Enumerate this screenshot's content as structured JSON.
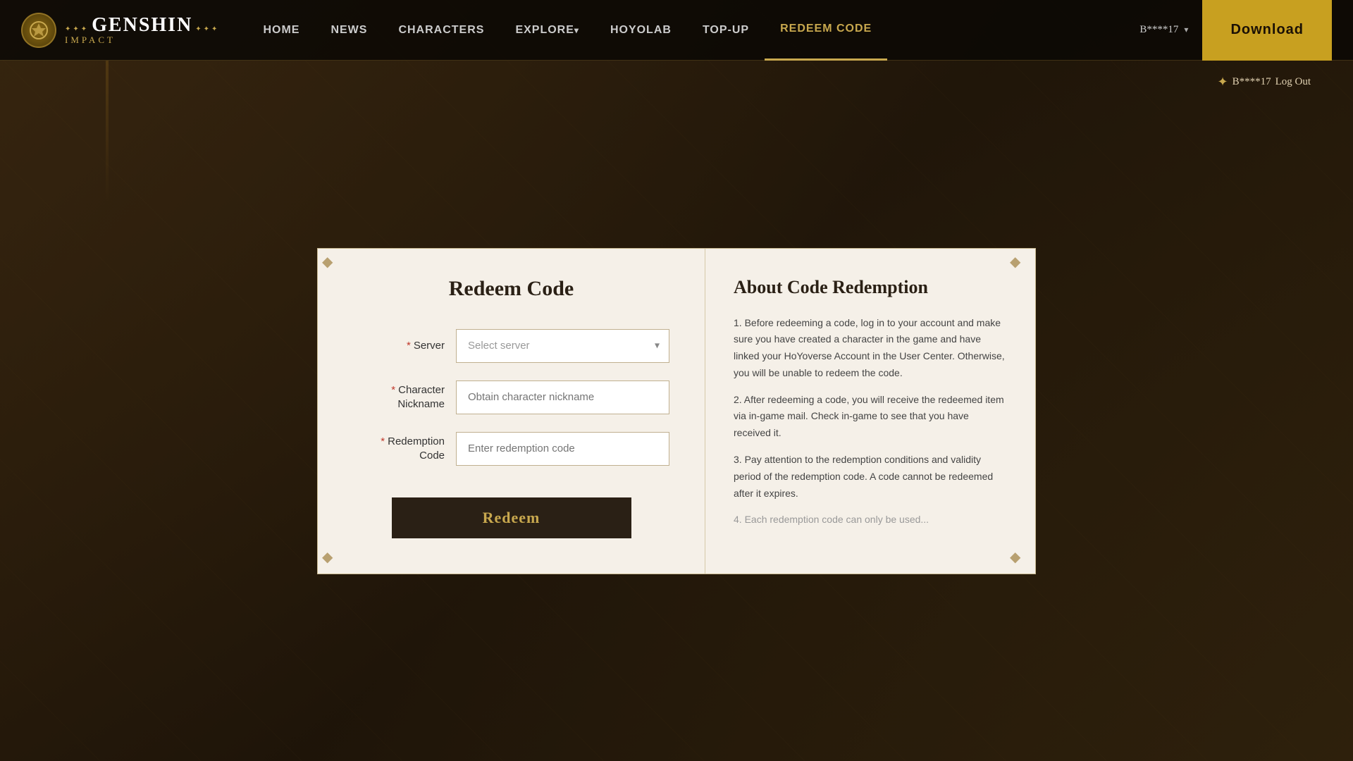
{
  "navbar": {
    "logo_main": "Genshin",
    "logo_sub": "IMPACT",
    "logo_stars": "✦ ✦ ✦",
    "nav_items": [
      {
        "label": "HOME",
        "active": false
      },
      {
        "label": "NEWS",
        "active": false
      },
      {
        "label": "CHARACTERS",
        "active": false
      },
      {
        "label": "EXPLORE",
        "active": false,
        "has_arrow": true
      },
      {
        "label": "HoYoLAB",
        "active": false
      },
      {
        "label": "TOP-UP",
        "active": false
      },
      {
        "label": "REDEEM CODE",
        "active": true
      }
    ],
    "user_label": "B****17",
    "download_label": "Download"
  },
  "user_logout": {
    "username": "B****17",
    "logout_label": "Log Out",
    "star": "✦"
  },
  "modal": {
    "left_title": "Redeem Code",
    "server_label": "Server",
    "server_placeholder": "Select server",
    "character_label": "Character\nNickname",
    "character_placeholder": "Obtain character nickname",
    "redemption_label": "Redemption\nCode",
    "redemption_placeholder": "Enter redemption code",
    "redeem_btn": "Redeem",
    "required_star": "*",
    "right_title": "About Code Redemption",
    "about_points": [
      "1. Before redeeming a code, log in to your account and make sure you have created a character in the game and have linked your HoYoverse Account in the User Center. Otherwise, you will be unable to redeem the code.",
      "2. After redeeming a code, you will receive the redeemed item via in-game mail. Check in-game to see that you have received it.",
      "3. Pay attention to the redemption conditions and validity period of the redemption code. A code cannot be redeemed after it expires.",
      "4. Each redemption code can only be used..."
    ],
    "corners": [
      "◆",
      "◆",
      "◆",
      "◆"
    ]
  }
}
